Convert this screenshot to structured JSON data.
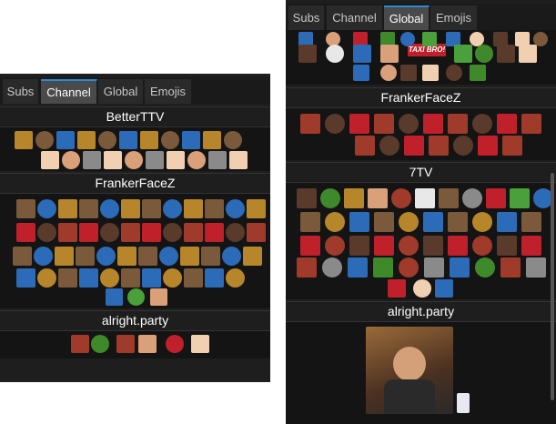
{
  "left": {
    "tabs": [
      {
        "label": "Subs",
        "active": false
      },
      {
        "label": "Channel",
        "active": true
      },
      {
        "label": "Global",
        "active": false
      },
      {
        "label": "Emojis",
        "active": false
      }
    ],
    "sections": [
      "BetterTTV",
      "FrankerFaceZ",
      "alright.party"
    ]
  },
  "right": {
    "tabs": [
      {
        "label": "Subs",
        "active": false
      },
      {
        "label": "Channel",
        "active": false
      },
      {
        "label": "Global",
        "active": true
      },
      {
        "label": "Emojis",
        "active": false
      }
    ],
    "sections": [
      "FrankerFaceZ",
      "7TV",
      "alright.party"
    ],
    "emote_text": {
      "taxi": "TAXI BRO!"
    }
  },
  "colors": {
    "panel_bg": "#1e1e1e",
    "emote_area_bg": "#141414",
    "tab_active_bg": "#4a4a4a",
    "tab_active_accent": "#2d8ad6",
    "tab_text": "#c8c8c8",
    "title_text": "#ffffff",
    "frog_green": "#3e8a2a",
    "skin": "#d9a07a",
    "red": "#c0202a",
    "blue": "#2b6bb8"
  }
}
